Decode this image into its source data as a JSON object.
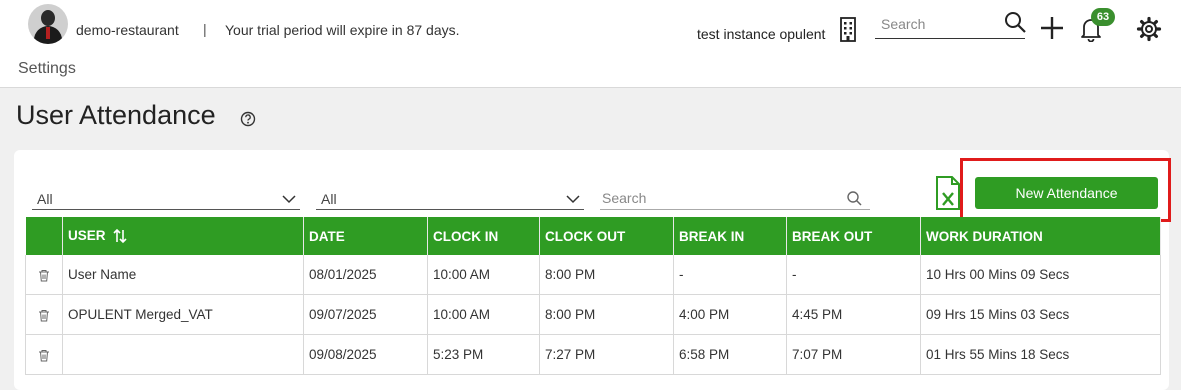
{
  "header": {
    "org_name": "demo-restaurant",
    "separator": "|",
    "trial_message": "Your trial period will expire in 87 days.",
    "instance_name": "test instance opulent",
    "search_placeholder": "Search",
    "notification_count": "63",
    "breadcrumb": "Settings"
  },
  "page": {
    "title": "User Attendance"
  },
  "filters": {
    "filter1_value": "All",
    "filter2_value": "All",
    "search_placeholder": "Search"
  },
  "actions": {
    "new_attendance_label": "New Attendance"
  },
  "table": {
    "columns": [
      "USER",
      "DATE",
      "CLOCK IN",
      "CLOCK OUT",
      "BREAK IN",
      "BREAK OUT",
      "WORK DURATION"
    ],
    "rows": [
      [
        "User Name",
        "08/01/2025",
        "10:00 AM",
        "8:00 PM",
        "-",
        "-",
        "10 Hrs 00 Mins 09 Secs"
      ],
      [
        "OPULENT Merged_VAT",
        "09/07/2025",
        "10:00 AM",
        "8:00 PM",
        "4:00 PM",
        "4:45 PM",
        "09 Hrs 15 Mins 03 Secs"
      ],
      [
        "",
        "09/08/2025",
        "5:23 PM",
        "7:27 PM",
        "6:58 PM",
        "7:07 PM",
        "01 Hrs 55 Mins 18 Secs"
      ]
    ]
  },
  "colors": {
    "accent_green": "#2f9c23",
    "highlight_red": "#e01b1b"
  },
  "icons": [
    "avatar",
    "building-icon",
    "search-icon",
    "plus-icon",
    "bell-icon",
    "gear-icon",
    "help-icon",
    "chevron-down-icon",
    "excel-icon",
    "sort-icon",
    "trash-icon"
  ]
}
